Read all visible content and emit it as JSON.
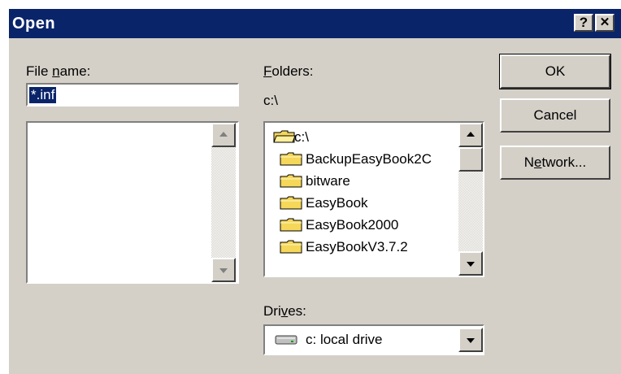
{
  "window": {
    "title": "Open"
  },
  "titlebar": {
    "help_label": "?",
    "close_label": "✕"
  },
  "filename": {
    "label_prefix": "File ",
    "label_mnemonic": "n",
    "label_suffix": "ame:",
    "value": "*.inf"
  },
  "folders": {
    "label_mnemonic": "F",
    "label_suffix": "olders:",
    "current_path": "c:\\",
    "items": [
      {
        "label": "c:\\",
        "icon": "open-folder-icon"
      },
      {
        "label": "BackupEasyBook2C",
        "icon": "folder-icon"
      },
      {
        "label": "bitware",
        "icon": "folder-icon"
      },
      {
        "label": "EasyBook",
        "icon": "folder-icon"
      },
      {
        "label": "EasyBook2000",
        "icon": "folder-icon"
      },
      {
        "label": "EasyBookV3.7.2",
        "icon": "folder-icon"
      }
    ]
  },
  "drives": {
    "label_prefix": "Dri",
    "label_mnemonic": "v",
    "label_suffix": "es:",
    "selected": "c: local drive",
    "icon": "hard-drive-icon"
  },
  "buttons": {
    "ok": "OK",
    "cancel": "Cancel",
    "network_prefix": "N",
    "network_mnemonic": "e",
    "network_suffix": "twork..."
  },
  "colors": {
    "titlebar": "#0a246a",
    "face": "#d4d0c8",
    "selection": "#0a246a",
    "folder": "#f5d75a"
  }
}
